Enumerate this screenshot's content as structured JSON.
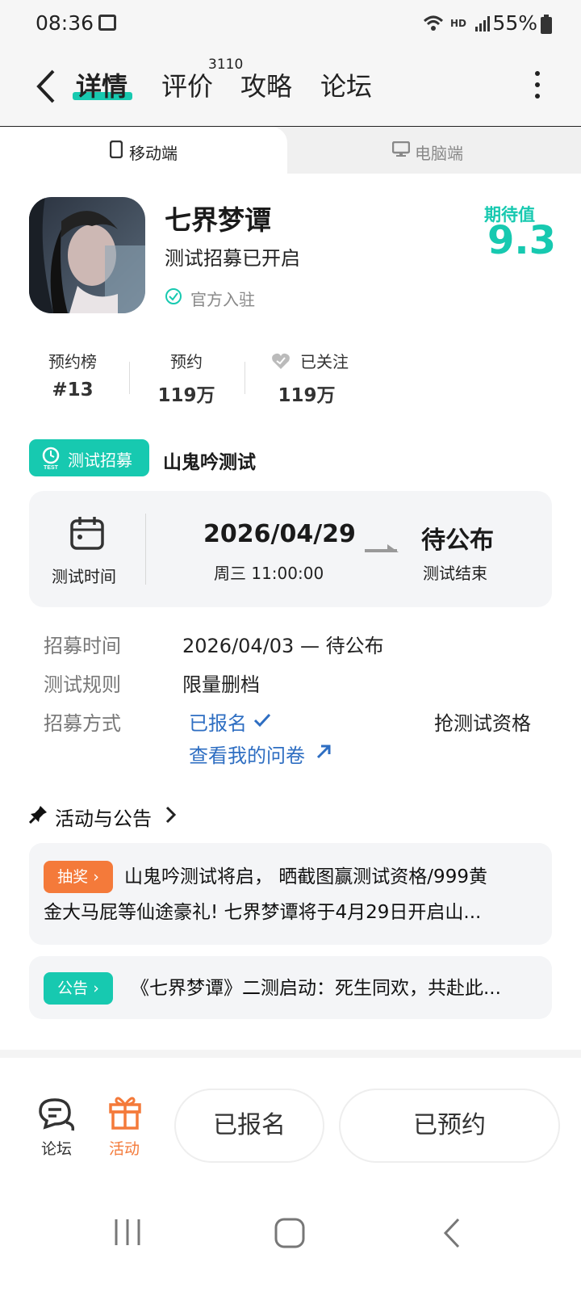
{
  "status": {
    "time": "08:36",
    "battery": "55%",
    "hd": "HD"
  },
  "nav": {
    "tabs": [
      {
        "label": "详情",
        "active": true
      },
      {
        "label": "评价",
        "badge": "3110"
      },
      {
        "label": "攻略"
      },
      {
        "label": "论坛"
      }
    ]
  },
  "platform": {
    "mobile": "移动端",
    "pc": "电脑端"
  },
  "game": {
    "title": "七界梦谭",
    "subtitle": "测试招募已开启",
    "official": "官方入驻",
    "expect_label": "期待值",
    "expect_value": "9.3"
  },
  "stats": [
    {
      "label": "预约榜",
      "value": "#13"
    },
    {
      "label": "预约",
      "value": "119万"
    },
    {
      "label": "已关注",
      "value": "119万"
    }
  ],
  "test": {
    "tag": "测试招募",
    "tag_icon": "TEST",
    "name": "山鬼吟测试",
    "time_label": "测试时间",
    "start_date": "2026/04/29",
    "start_sub": "周三  11:00:00",
    "end_value": "待公布",
    "end_sub": "测试结束"
  },
  "info": {
    "recruit_key": "招募时间",
    "recruit_val": "2026/04/03 — 待公布",
    "rule_key": "测试规则",
    "rule_val": "限量删档",
    "method_key": "招募方式",
    "signed": "已报名",
    "questionnaire": "查看我的问卷",
    "grab": "抢测试资格"
  },
  "activities": {
    "title": "活动与公告",
    "items": [
      {
        "tag": "抽奖",
        "tag_color": "#f47a3a",
        "text1": "山鬼吟测试将启， 晒截图赢测试资格/999黄",
        "text2": "金大马屁等仙途豪礼! 七界梦谭将于4月29日开启山..."
      },
      {
        "tag": "公告",
        "tag_color": "#17c9b0",
        "text1": "《七界梦谭》二测启动：死生同欢，共赴此..."
      }
    ]
  },
  "bottom": {
    "forum": "论坛",
    "activity": "活动",
    "signed_btn": "已报名",
    "reserved_btn": "已预约"
  },
  "colors": {
    "accent": "#17c9b0",
    "orange": "#f47a3a",
    "link": "#2e6ec2"
  }
}
